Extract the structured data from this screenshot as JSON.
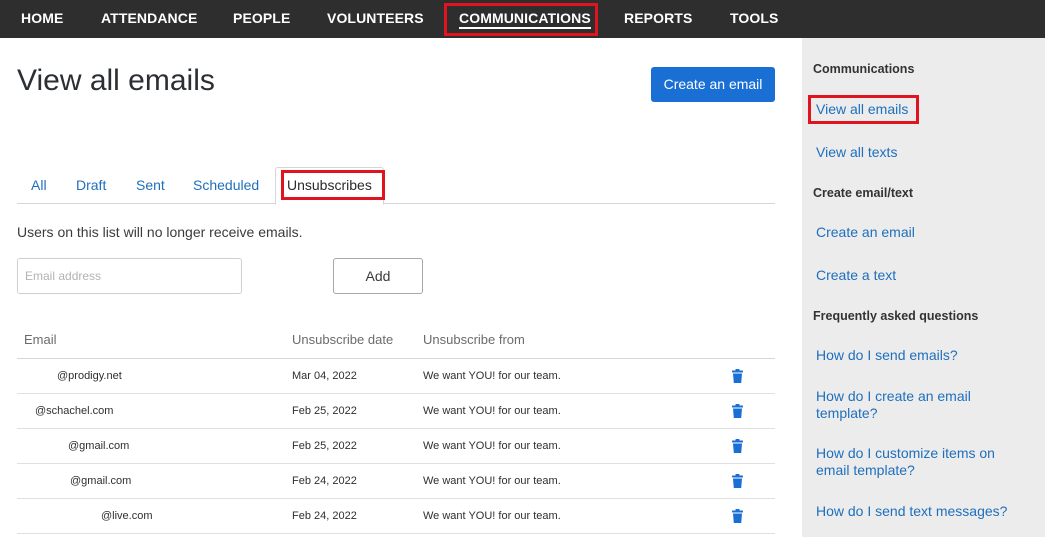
{
  "nav": {
    "items": [
      {
        "label": "HOME"
      },
      {
        "label": "ATTENDANCE"
      },
      {
        "label": "PEOPLE"
      },
      {
        "label": "VOLUNTEERS"
      },
      {
        "label": "COMMUNICATIONS",
        "active": true
      },
      {
        "label": "REPORTS"
      },
      {
        "label": "TOOLS"
      }
    ]
  },
  "main": {
    "title": "View all emails",
    "create_button": "Create an email",
    "tabs": [
      {
        "label": "All"
      },
      {
        "label": "Draft"
      },
      {
        "label": "Sent"
      },
      {
        "label": "Scheduled"
      },
      {
        "label": "Unsubscribes",
        "active": true
      }
    ],
    "info_text": "Users on this list will no longer receive emails.",
    "email_placeholder": "Email address",
    "add_button": "Add",
    "table": {
      "headers": {
        "email": "Email",
        "date": "Unsubscribe date",
        "from": "Unsubscribe from"
      },
      "rows": [
        {
          "email": "@prodigy.net",
          "date": "Mar 04, 2022",
          "from": "We want YOU! for our team."
        },
        {
          "email": "@schachel.com",
          "date": "Feb 25, 2022",
          "from": "We want YOU! for our team."
        },
        {
          "email": "@gmail.com",
          "date": "Feb 25, 2022",
          "from": "We want YOU! for our team."
        },
        {
          "email": "@gmail.com",
          "date": "Feb 24, 2022",
          "from": "We want YOU! for our team."
        },
        {
          "email": "@live.com",
          "date": "Feb 24, 2022",
          "from": "We want YOU! for our team."
        }
      ]
    }
  },
  "sidebar": {
    "heading_communications": "Communications",
    "link_view_emails": "View all emails",
    "link_view_texts": "View all texts",
    "heading_create": "Create email/text",
    "link_create_email": "Create an email",
    "link_create_text": "Create a text",
    "heading_faq": "Frequently asked questions",
    "faq": [
      "How do I send emails?",
      "How do I create an email template?",
      "How do I customize items on email template?",
      "How do I send text messages?"
    ]
  },
  "colors": {
    "nav_bg": "#2e2e2e",
    "accent": "#1a6fd4",
    "link": "#1e6fbd",
    "highlight": "#e0141e",
    "sidebar_bg": "#ececec"
  },
  "icons": {
    "row_action": "trash-icon"
  }
}
